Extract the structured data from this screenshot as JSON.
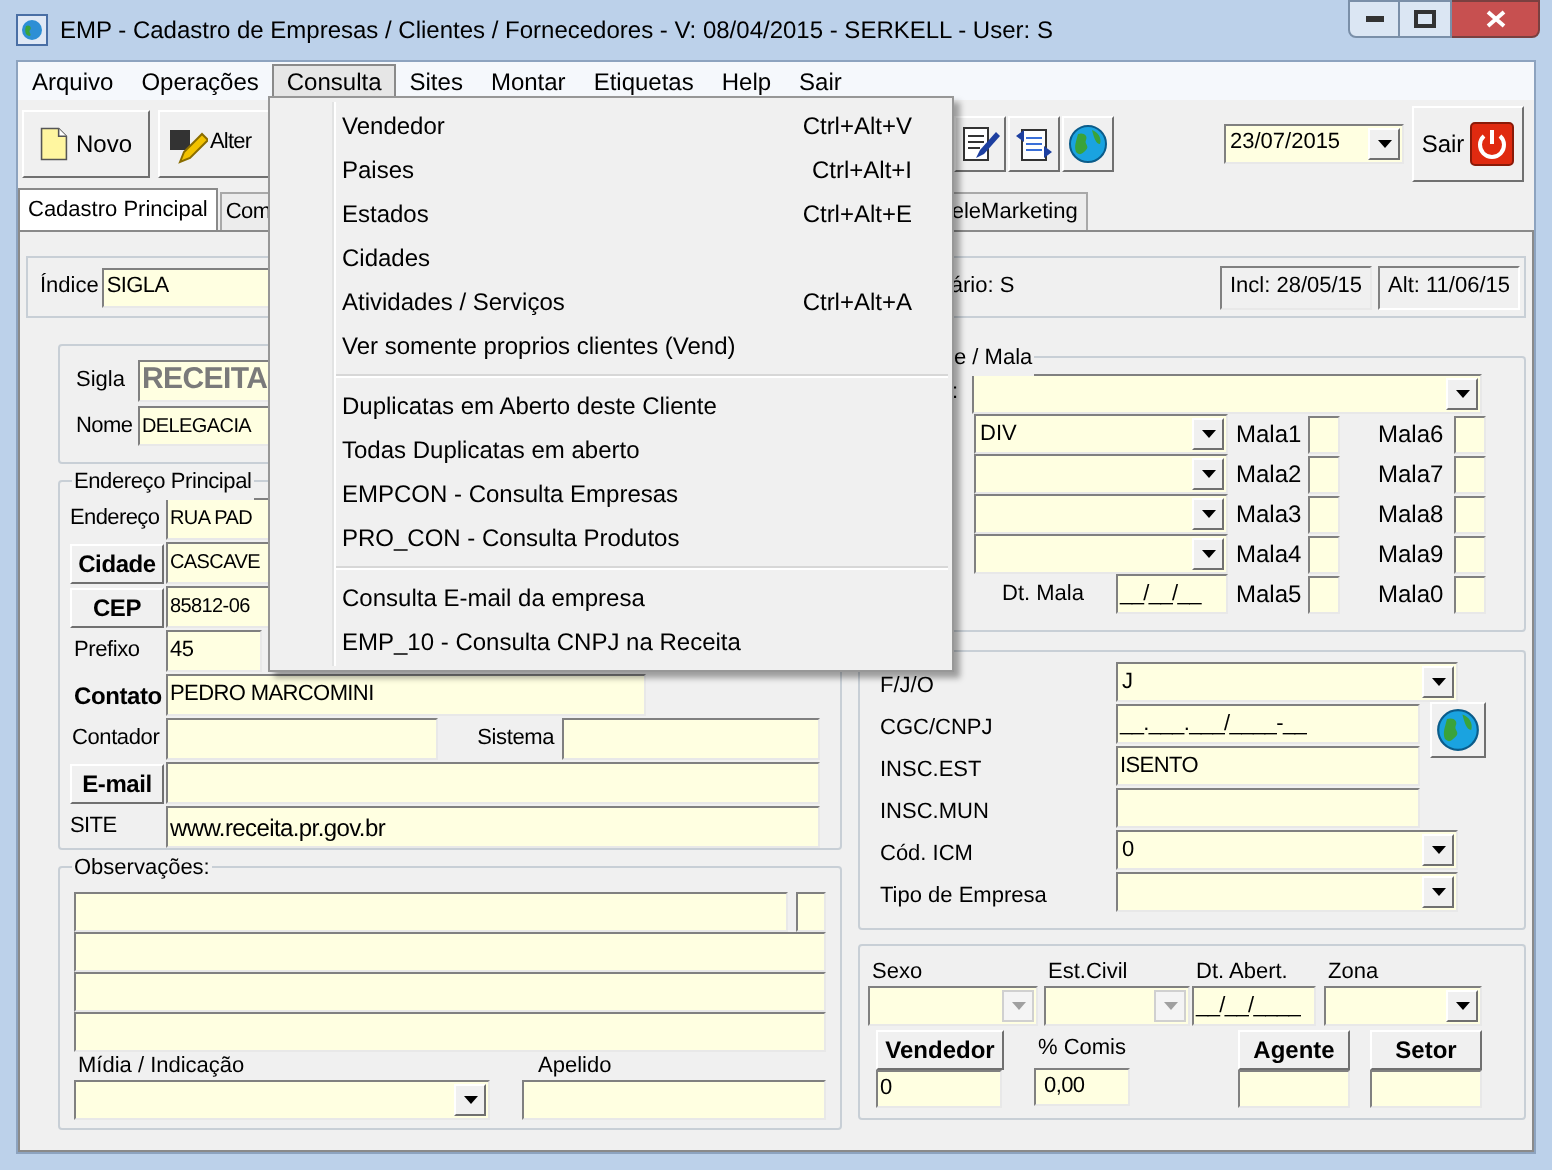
{
  "window": {
    "title": "EMP - Cadastro de Empresas / Clientes / Fornecedores - V: 08/04/2015 - SERKELL - User: S"
  },
  "menu_bar": [
    {
      "label": "Arquivo",
      "selected": false
    },
    {
      "label": "Operações",
      "selected": false
    },
    {
      "label": "Consulta",
      "selected": true
    },
    {
      "label": "Sites",
      "selected": false
    },
    {
      "label": "Montar",
      "selected": false
    },
    {
      "label": "Etiquetas",
      "selected": false
    },
    {
      "label": "Help",
      "selected": false
    },
    {
      "label": "Sair",
      "selected": false
    }
  ],
  "open_menu": {
    "sections": [
      {
        "items": [
          {
            "label": "Vendedor",
            "shortcut": "Ctrl+Alt+V"
          },
          {
            "label": "Paises",
            "shortcut": "Ctrl+Alt+I"
          },
          {
            "label": "Estados",
            "shortcut": "Ctrl+Alt+E"
          },
          {
            "label": "Cidades"
          },
          {
            "label": "Atividades / Serviços",
            "shortcut": "Ctrl+Alt+A"
          },
          {
            "label": "Ver somente proprios clientes (Vend)"
          }
        ]
      },
      {
        "items": [
          {
            "label": "Duplicatas em Aberto deste Cliente"
          },
          {
            "label": "Todas Duplicatas em aberto"
          },
          {
            "label": "EMPCON - Consulta Empresas"
          },
          {
            "label": "PRO_CON - Consulta Produtos"
          }
        ]
      },
      {
        "items": [
          {
            "label": "Consulta E-mail da empresa"
          },
          {
            "label": "EMP_10 - Consulta CNPJ na  Receita"
          }
        ]
      }
    ]
  },
  "toolbar": {
    "buttons": [
      {
        "label": "Novo",
        "kind": "new"
      },
      {
        "label": "Alter",
        "kind": "edit"
      }
    ],
    "date": "23/07/2015",
    "exit_button": "Sair"
  },
  "tabs": [
    {
      "label": "Cadastro Principal",
      "selected": true
    },
    {
      "label": "Com",
      "selected": false
    },
    {
      "label": "eleMarketing",
      "selected": false
    }
  ],
  "header": {
    "index_label": "Índice",
    "index_value": "SIGLA",
    "user_text": "ário: S",
    "included": "Incl: 28/05/15",
    "altered": "Alt: 11/06/15"
  },
  "identity": {
    "sigla_label": "Sigla",
    "sigla": "RECEITA",
    "nome_label": "Nome",
    "nome": "DELEGACIA"
  },
  "address": {
    "title": "Endereço Principal",
    "rows": [
      {
        "kind": "text",
        "label": "Endereço",
        "value": "RUA PAD"
      },
      {
        "kind": "button",
        "label": "Cidade",
        "value": "CASCAVE"
      },
      {
        "kind": "button",
        "label": "CEP",
        "value": "85812-06"
      },
      {
        "kind": "short",
        "label": "Prefixo",
        "value": "45"
      },
      {
        "kind": "bold",
        "label": "Contato",
        "value": "PEDRO MARCOMINI"
      },
      {
        "kind": "split",
        "label": "Contador",
        "label_2": "Sistema"
      },
      {
        "kind": "button",
        "label": "E-mail"
      },
      {
        "kind": "text",
        "label": "SITE",
        "value": "www.receita.pr.gov.br"
      }
    ]
  },
  "notes": {
    "title": "Observações:",
    "midia_label": "Mídia / Indicação",
    "apelido_label": "Apelido"
  },
  "mala": {
    "title": "e / Mala",
    "label_tail": ":",
    "combo_value": "DIV",
    "dt_label": "Dt. Mala",
    "dt_value": "__/__/__",
    "labels": [
      "Mala1",
      "Mala2",
      "Mala3",
      "Mala4",
      "Mala5"
    ],
    "labels_2": [
      "Mala6",
      "Mala7",
      "Mala8",
      "Mala9",
      "Mala0"
    ]
  },
  "fiscal": {
    "rows": [
      {
        "kind": "dropdown",
        "label": "F/J/O",
        "value": "J"
      },
      {
        "kind": "lookup",
        "label": "CGC/CNPJ",
        "value": "__.___.___/____-__"
      },
      {
        "kind": "text",
        "label": "INSC.EST",
        "value": "ISENTO"
      },
      {
        "kind": "text",
        "label": "INSC.MUN"
      },
      {
        "kind": "dropdown",
        "label": "Cód. ICM",
        "value": "0"
      },
      {
        "kind": "dropdown",
        "label": "Tipo de Empresa"
      }
    ]
  },
  "extra": {
    "combos": [
      {
        "label": "Sexo",
        "kind": "dropdown",
        "disabled": true
      },
      {
        "label": "Est.Civil",
        "kind": "dropdown",
        "disabled": true
      },
      {
        "label": "Dt. Abert.",
        "kind": "date",
        "value": "__/__/____"
      },
      {
        "label": "Zona",
        "kind": "dropdown",
        "disabled": false
      }
    ],
    "vendedor_button": "Vendedor",
    "vendedor_value": "0",
    "comis_label": "% Comis",
    "comis_value": "0,00",
    "agente_button": "Agente",
    "setor_button": "Setor"
  }
}
